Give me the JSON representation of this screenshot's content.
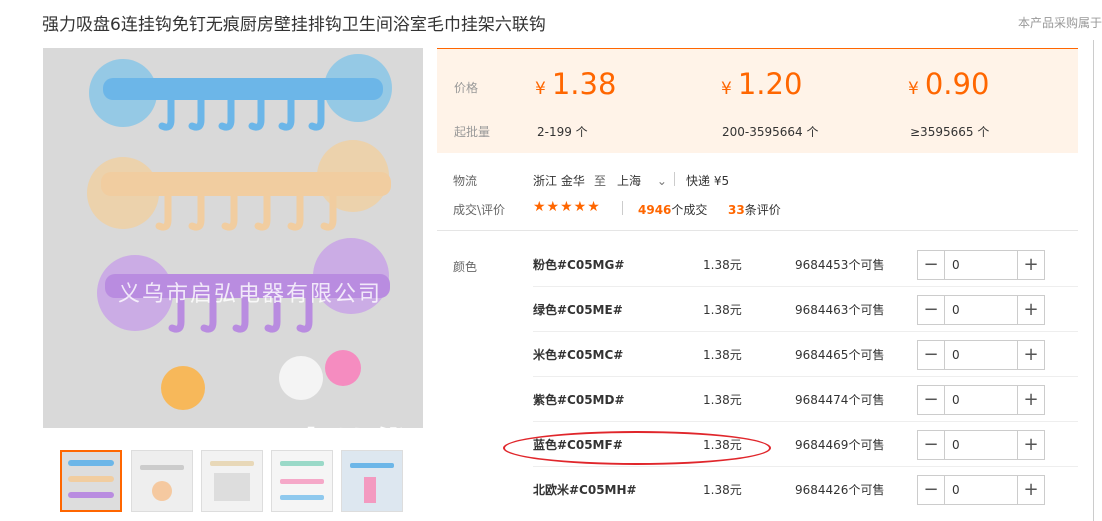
{
  "header": {
    "title": "强力吸盘6连挂钩免钉无痕厨房壁挂排钩卫生间浴室毛巾挂架六联钩",
    "note": "本产品采购属于"
  },
  "gallery": {
    "watermark": "义乌市启弘电器有限公司",
    "promo_text": "量大从优",
    "thumbnail_count": 5,
    "active_thumbnail": 1
  },
  "price_box": {
    "price_label": "价格",
    "moq_label": "起批量",
    "currency": "¥",
    "tiers": [
      {
        "price": "1.38",
        "range": "2-199 个"
      },
      {
        "price": "1.20",
        "range": "200-3595664 个"
      },
      {
        "price": "0.90",
        "range": "≥3595665 个"
      }
    ]
  },
  "logistics": {
    "label": "物流",
    "from": "浙江 金华",
    "to_word": "至",
    "to": "上海",
    "express": "快递 ¥5"
  },
  "deals": {
    "label": "成交\\评价",
    "stars": "★★★★★",
    "deal_count": "4946",
    "deal_suffix": "个成交",
    "review_count": "33",
    "review_suffix": "条评价"
  },
  "sku": {
    "label": "颜色",
    "minus": "−",
    "plus": "+",
    "rows": [
      {
        "name": "粉色#C05MG#",
        "price": "1.38元",
        "stock": "9684453个可售",
        "qty": "0"
      },
      {
        "name": "绿色#C05ME#",
        "price": "1.38元",
        "stock": "9684463个可售",
        "qty": "0"
      },
      {
        "name": "米色#C05MC#",
        "price": "1.38元",
        "stock": "9684465个可售",
        "qty": "0"
      },
      {
        "name": "紫色#C05MD#",
        "price": "1.38元",
        "stock": "9684474个可售",
        "qty": "0"
      },
      {
        "name": "蓝色#C05MF#",
        "price": "1.38元",
        "stock": "9684469个可售",
        "qty": "0"
      },
      {
        "name": "北欧米#C05MH#",
        "price": "1.38元",
        "stock": "9684426个可售",
        "qty": "0"
      }
    ]
  },
  "colors": {
    "accent": "#ff6600",
    "annotation": "#e0262b",
    "price_bg": "#fff3e8"
  }
}
